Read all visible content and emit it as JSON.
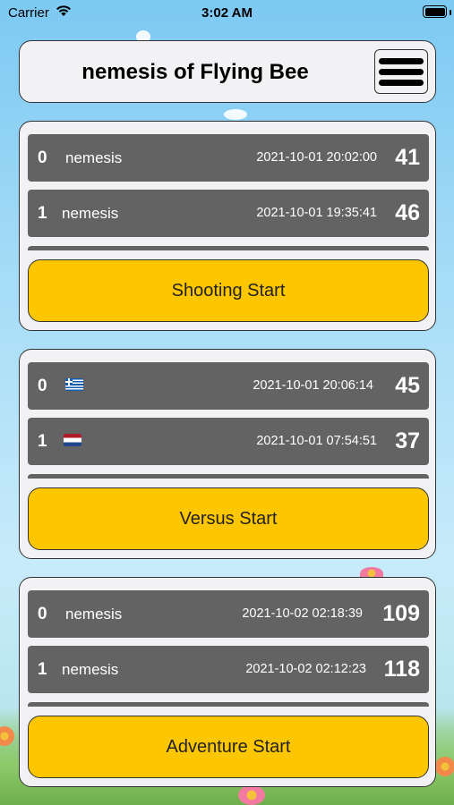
{
  "status_bar": {
    "carrier": "Carrier",
    "time": "3:02 AM",
    "wifi_icon": "wifi-icon",
    "battery_icon": "battery-icon"
  },
  "header": {
    "title": "nemesis of Flying Bee",
    "menu_icon": "hamburger-menu-icon"
  },
  "panels": [
    {
      "rows": [
        {
          "rank": "0",
          "name": "nemesis",
          "date": "2021-10-01 20:02:00",
          "score": "41"
        },
        {
          "rank": "1",
          "name": "nemesis",
          "date": "2021-10-01 19:35:41",
          "score": "46"
        }
      ],
      "button_label": "Shooting Start"
    },
    {
      "rows": [
        {
          "rank": "0",
          "flag": "greece-flag-icon",
          "date": "2021-10-01 20:06:14",
          "score": "45"
        },
        {
          "rank": "1",
          "flag": "netherlands-flag-icon",
          "date": "2021-10-01 07:54:51",
          "score": "37"
        }
      ],
      "button_label": "Versus Start"
    },
    {
      "rows": [
        {
          "rank": "0",
          "name": "nemesis",
          "date": "2021-10-02 02:18:39",
          "score": "109"
        },
        {
          "rank": "1",
          "name": "nemesis",
          "date": "2021-10-02 02:12:23",
          "score": "118"
        }
      ],
      "button_label": "Adventure Start"
    }
  ],
  "colors": {
    "button_yellow": "#fcc600",
    "row_gray": "#636363",
    "panel_bg": "#f2f2f4"
  }
}
